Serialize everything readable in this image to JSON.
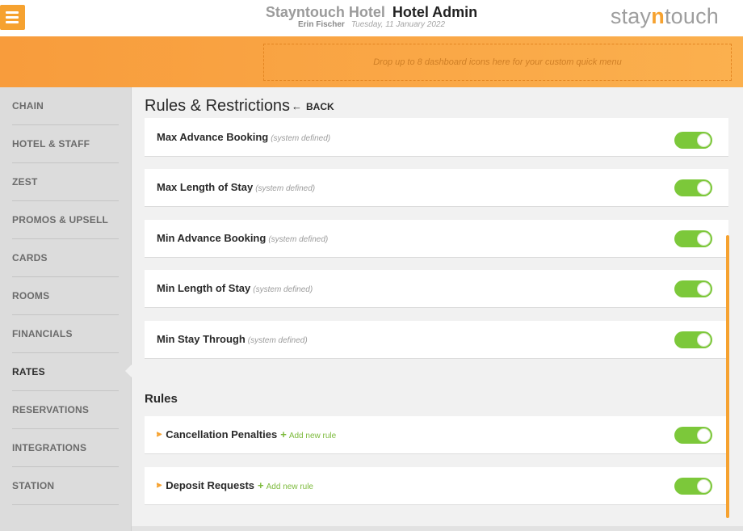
{
  "header": {
    "hotel_name": "Stayntouch Hotel",
    "section": "Hotel Admin",
    "user": "Erin Fischer",
    "date": "Tuesday, 11 January 2022",
    "logo_pre": "stay",
    "logo_n": "n",
    "logo_post": "touch",
    "menu_icon": "hamburger-icon"
  },
  "quick_menu": {
    "drop_text": "Drop up to 8 dashboard icons here for your custom quick menu"
  },
  "sidebar": {
    "items": [
      {
        "label": "CHAIN"
      },
      {
        "label": "HOTEL & STAFF"
      },
      {
        "label": "ZEST"
      },
      {
        "label": "PROMOS & UPSELL"
      },
      {
        "label": "CARDS"
      },
      {
        "label": "ROOMS"
      },
      {
        "label": "FINANCIALS"
      },
      {
        "label": "RATES",
        "active": true
      },
      {
        "label": "RESERVATIONS"
      },
      {
        "label": "INTEGRATIONS"
      },
      {
        "label": "STATION"
      }
    ]
  },
  "page": {
    "title": "Rules & Restrictions",
    "back_label": "BACK",
    "back_icon": "arrow-left-icon"
  },
  "restrictions": [
    {
      "name": "Max Advance Booking",
      "hint": "(system defined)",
      "enabled": true
    },
    {
      "name": "Max Length of Stay",
      "hint": "(system defined)",
      "enabled": true
    },
    {
      "name": "Min Advance Booking",
      "hint": "(system defined)",
      "enabled": true
    },
    {
      "name": "Min Length of Stay",
      "hint": "(system defined)",
      "enabled": true
    },
    {
      "name": "Min Stay Through",
      "hint": "(system defined)",
      "enabled": true
    }
  ],
  "rules_section": {
    "title": "Rules",
    "items": [
      {
        "name": "Cancellation Penalties",
        "add_label": "Add new rule",
        "enabled": true
      },
      {
        "name": "Deposit Requests",
        "add_label": "Add new rule",
        "enabled": true
      }
    ]
  },
  "colors": {
    "accent_orange": "#f6a230",
    "toggle_on": "#7cc83a",
    "add_link": "#7cba3b"
  }
}
